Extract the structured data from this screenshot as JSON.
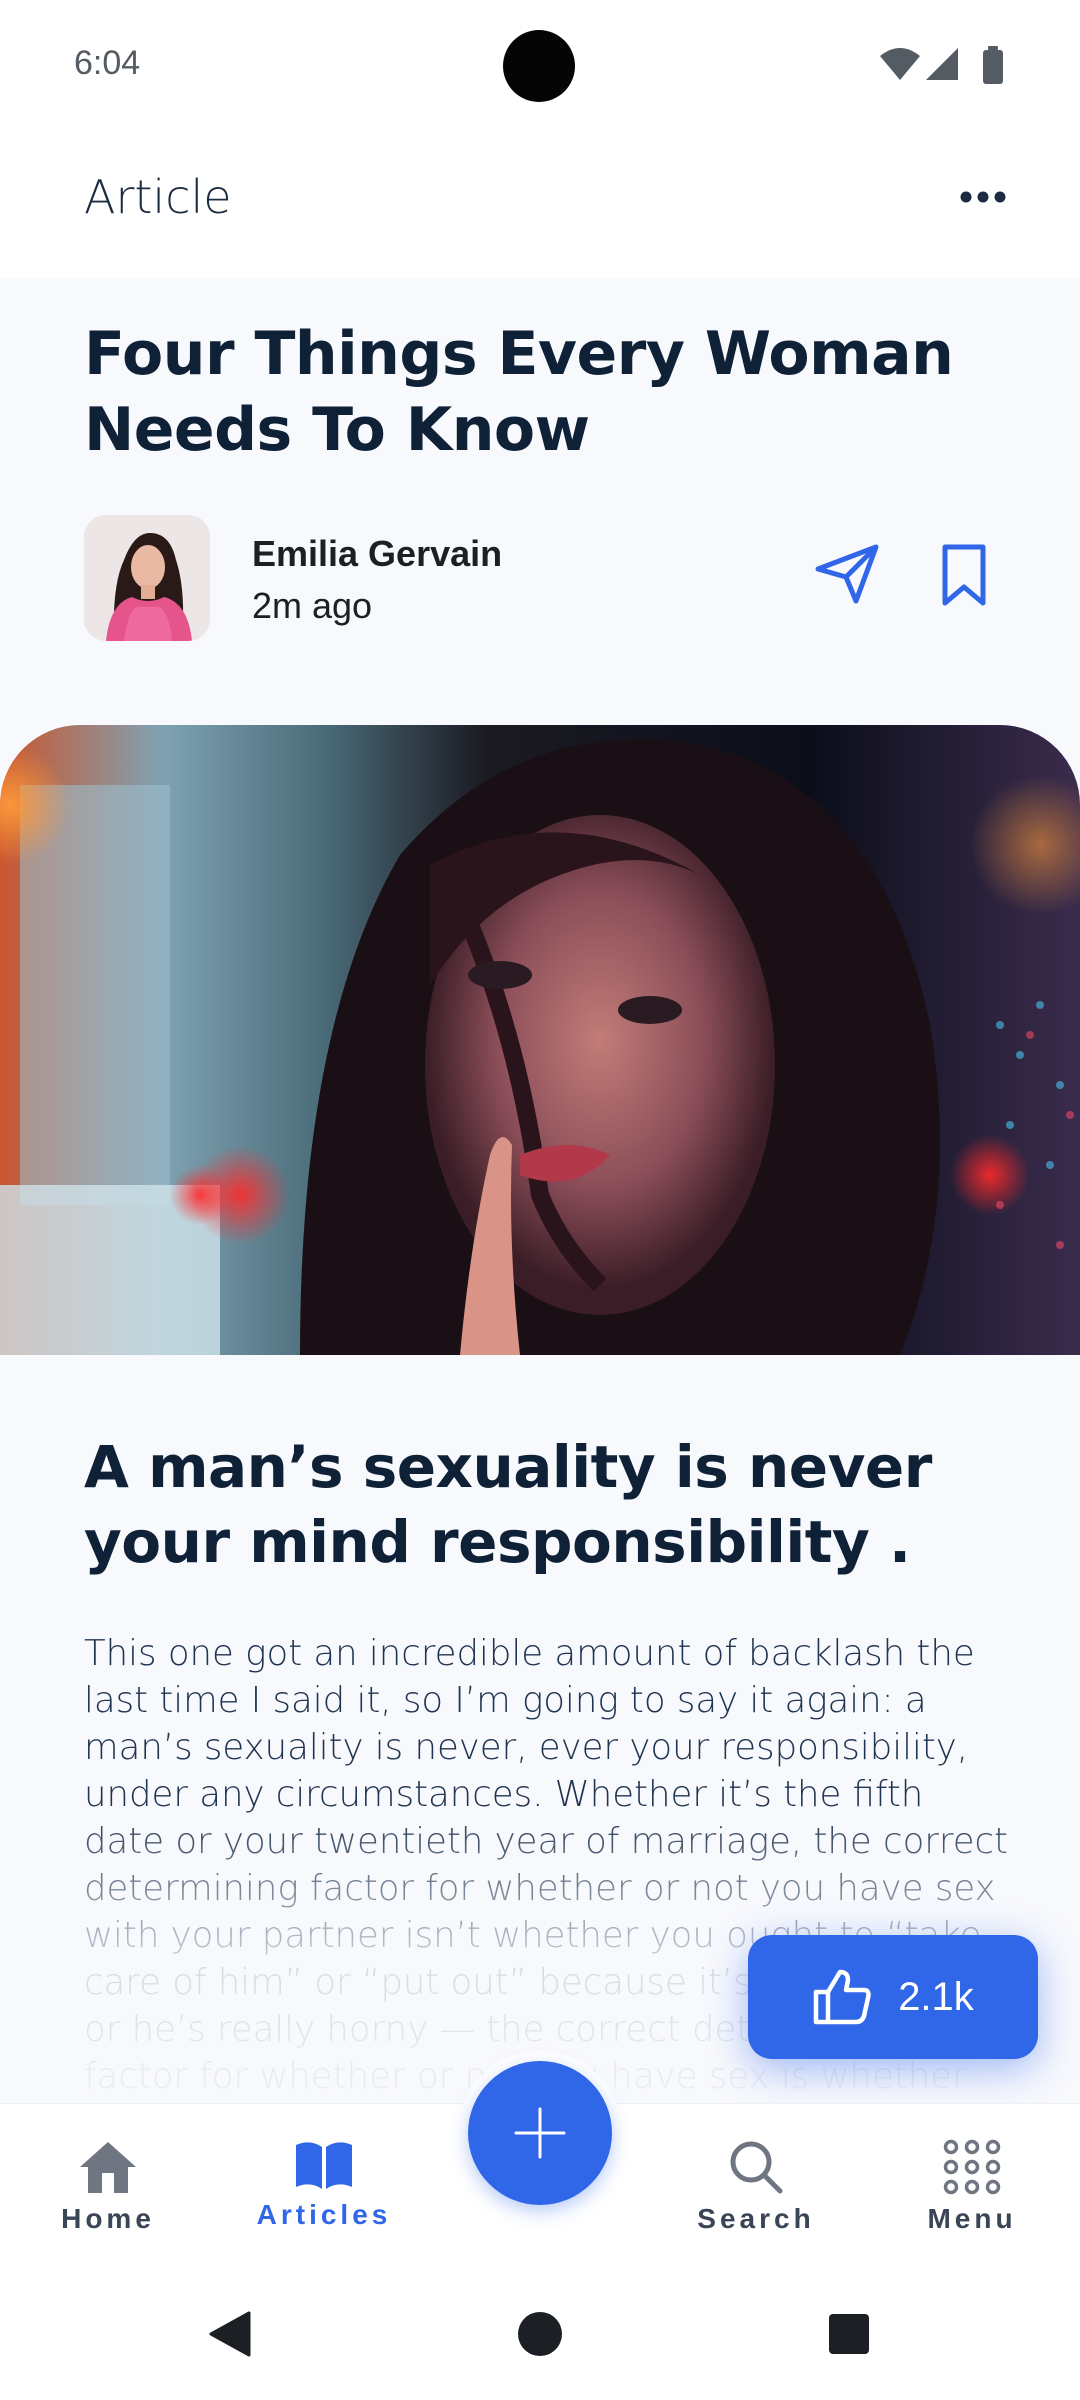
{
  "status_bar": {
    "time": "6:04",
    "icons": [
      "wifi-icon",
      "signal-icon",
      "battery-icon"
    ]
  },
  "header": {
    "title": "Article",
    "more_icon": "more-horizontal-icon"
  },
  "article": {
    "title": "Four Things Every Woman Needs To Know",
    "author": {
      "name": "Emilia Gervain",
      "time": "2m ago"
    },
    "share_icon": "send-icon",
    "bookmark_icon": "bookmark-icon",
    "section_heading": "A man’s sexuality is never your mind responsibility .",
    "body": "This one got an incredible amount of backlash the last time I said it, so I’m going to say it again: a man’s sexuality is never, ever your responsibility, under any circumstances. Whether it’s the fifth date or your twentieth year of marriage, the correct determining factor for whether or not you have sex with your partner isn’t whether you ought to “take care of him” or “put out” because it’s been a while or he’s really horny — the correct determining factor for whether or not you have sex is whether or"
  },
  "like_button": {
    "count": "2.1k",
    "icon": "thumbs-up-icon"
  },
  "bottom_nav": {
    "items": [
      {
        "label": "Home",
        "icon": "home-icon",
        "active": false
      },
      {
        "label": "Articles",
        "icon": "book-open-icon",
        "active": true
      },
      {
        "label": "Search",
        "icon": "search-icon",
        "active": false
      },
      {
        "label": "Menu",
        "icon": "grid-icon",
        "active": false
      }
    ],
    "fab_icon": "plus-icon"
  },
  "system_nav": [
    "back-icon",
    "home-circle-icon",
    "recents-icon"
  ],
  "colors": {
    "accent": "#3066e8",
    "title": "#0f2136",
    "body": "#1f3450",
    "background": "#f8f9fd"
  }
}
